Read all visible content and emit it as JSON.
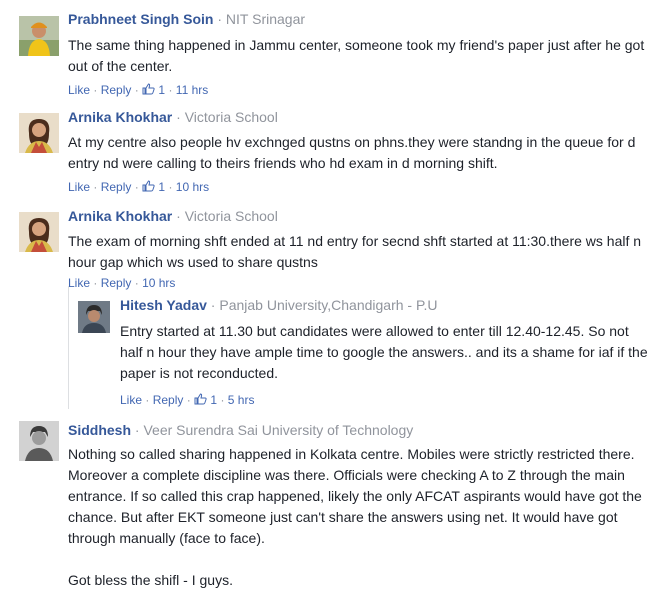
{
  "comments": [
    {
      "name": "Prabhneet Singh Soin",
      "affiliation": "NIT Srinagar",
      "lines": [
        "The same thing happened in Jammu center, someone took my friend's paper just after he got",
        "out of the center."
      ],
      "like_label": "Like",
      "reply_label": "Reply",
      "likes": "1",
      "time": "11 hrs"
    },
    {
      "name": "Arnika Khokhar",
      "affiliation": "Victoria School",
      "lines": [
        "At my centre also people hv exchnged qustns on phns.they were standng in the queue for d",
        "entry nd were calling to theirs friends who hd exam in d morning shift."
      ],
      "like_label": "Like",
      "reply_label": "Reply",
      "likes": "1",
      "time": "10 hrs"
    },
    {
      "name": "Arnika Khokhar",
      "affiliation": "Victoria School",
      "lines": [
        "The exam of morning shft ended at 11 nd entry for secnd shft started at 11:30.there ws half n",
        "hour gap which ws used to share qustns"
      ],
      "like_label": "Like",
      "reply_label": "Reply",
      "time": "10 hrs"
    },
    {
      "name": "Hitesh Yadav",
      "affiliation": "Panjab University,Chandigarh - P.U",
      "lines": [
        "Entry started at 11.30 but candidates were allowed to enter till 12.40-12.45. So not",
        "half n hour they have ample time to google the answers.. and its a shame for iaf if the",
        "paper is not reconducted."
      ],
      "like_label": "Like",
      "reply_label": "Reply",
      "likes": "1",
      "time": "5 hrs"
    },
    {
      "name": "Siddhesh",
      "affiliation": "Veer Surendra Sai University of Technology",
      "lines": [
        "Nothing so called sharing happened in Kolkata centre. Mobiles were strictly restricted there.",
        "Moreover a complete discipline was there. Officials were checking A to Z through the main",
        "entrance. If so called this crap happened, likely the only AFCAT aspirants would have got the",
        "chance. But after EKT someone just can't share the answers using net. It would have got",
        "through manually (face to face).",
        "",
        "Got bless the shifl - I guys."
      ]
    }
  ],
  "colors": {
    "name": "#365899",
    "link": "#4267b2",
    "meta": "#90949c",
    "text": "#1d2129"
  },
  "icons": {
    "like": "thumbs-up-icon"
  }
}
